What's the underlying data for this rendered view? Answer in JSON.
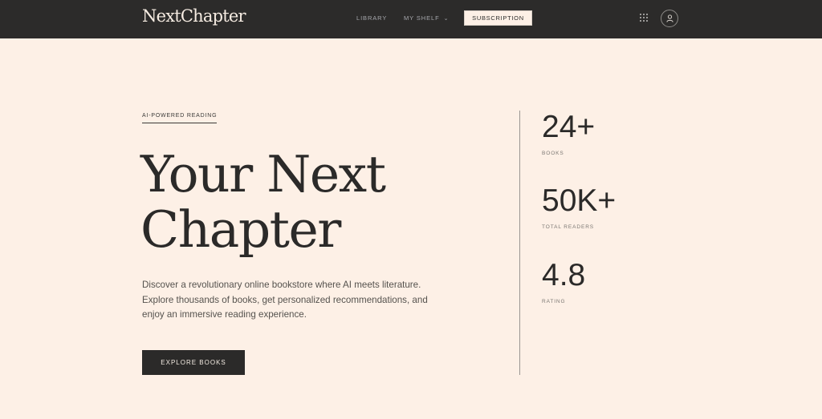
{
  "header": {
    "logo": "NextChapter",
    "nav": {
      "library": "LIBRARY",
      "my_shelf": "MY SHELF",
      "my_shelf_chevron": "⌄",
      "subscription": "SUBSCRIPTION"
    },
    "icons": [
      "grid-icon",
      "user-icon"
    ]
  },
  "hero": {
    "eyebrow": "AI-POWERED READING",
    "headline_line1": "Your Next",
    "headline_line2": "Chapter",
    "description": "Discover a revolutionary online bookstore where AI meets literature. Explore thousands of books, get personalized recommendations, and enjoy an immersive reading experience.",
    "cta": "EXPLORE BOOKS"
  },
  "stats": [
    {
      "value": "24+",
      "label": "BOOKS"
    },
    {
      "value": "50K+",
      "label": "TOTAL READERS"
    },
    {
      "value": "4.8",
      "label": "RATING"
    }
  ],
  "colors": {
    "header_bg": "#2c2b2a",
    "page_bg": "#fdf0e6",
    "text_dark": "#2b2a29",
    "nav_text": "#a7a8ad"
  }
}
